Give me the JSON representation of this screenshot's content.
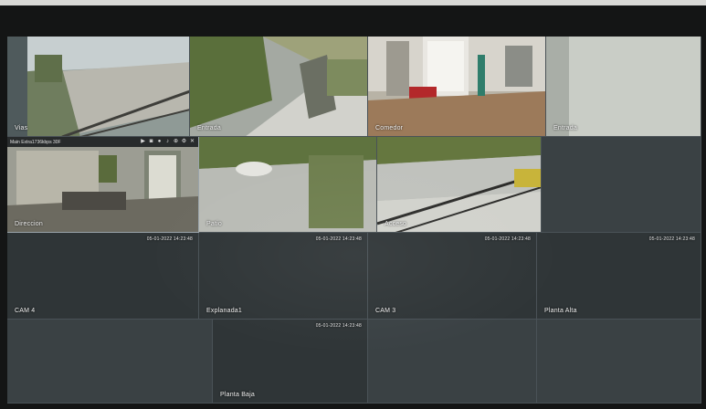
{
  "grid": {
    "tiles": [
      {
        "name": "Vias",
        "timestamp": "",
        "kind": "feed"
      },
      {
        "name": "Entrada",
        "timestamp": "",
        "kind": "feed"
      },
      {
        "name": "Comedor",
        "timestamp": "",
        "kind": "feed"
      },
      {
        "name": "Entrada",
        "timestamp": "",
        "kind": "feed"
      },
      {
        "name": "Direccion",
        "timestamp": "",
        "kind": "feed"
      },
      {
        "name": "Patio",
        "timestamp": "",
        "kind": "feed"
      },
      {
        "name": "Acceso",
        "timestamp": "",
        "kind": "feed"
      },
      {
        "name": "",
        "timestamp": "",
        "kind": "empty"
      },
      {
        "name": "CAM 4",
        "timestamp": "05-01-2022 14:23:48",
        "kind": "nosig"
      },
      {
        "name": "Explanada1",
        "timestamp": "05-01-2022 14:23:48",
        "kind": "nosig"
      },
      {
        "name": "CAM 3",
        "timestamp": "05-01-2022 14:23:48",
        "kind": "nosig"
      },
      {
        "name": "Planta Alta",
        "timestamp": "05-01-2022 14:23:48",
        "kind": "nosig"
      },
      {
        "name": "",
        "timestamp": "",
        "kind": "empty"
      },
      {
        "name": "Planta Baja",
        "timestamp": "05-01-2022 14:23:48",
        "kind": "nosig"
      },
      {
        "name": "",
        "timestamp": "",
        "kind": "empty"
      },
      {
        "name": "",
        "timestamp": "",
        "kind": "empty"
      }
    ]
  },
  "toolbar": {
    "info": "Main Extra1736kbps 30F",
    "icons": [
      "playback-icon",
      "snapshot-icon",
      "record-icon",
      "audio-icon",
      "zoom-icon",
      "settings-icon",
      "close-icon"
    ]
  }
}
